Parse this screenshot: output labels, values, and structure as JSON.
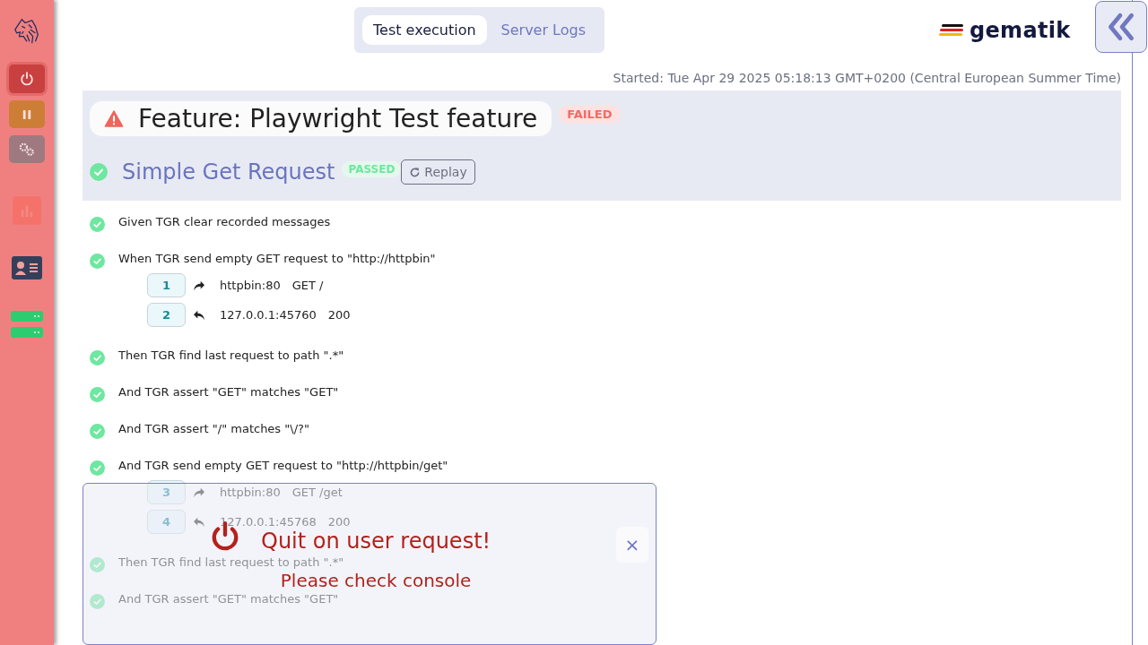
{
  "sidebar": {
    "buttons": [
      {
        "kind": "quit",
        "disabled": false
      },
      {
        "kind": "pause",
        "disabled": false
      },
      {
        "kind": "settings",
        "disabled": false
      },
      {
        "kind": "chart",
        "disabled": true
      },
      {
        "kind": "info",
        "disabled": false
      },
      {
        "kind": "status",
        "disabled": false
      }
    ]
  },
  "tabs": [
    {
      "label": "Test execution",
      "selected": true
    },
    {
      "label": "Server Logs",
      "selected": false
    }
  ],
  "logo": {
    "text": "gematik"
  },
  "started": "Started: Tue Apr 29 2025 05:18:13 GMT+0200 (Central European Summer Time)",
  "feature": {
    "title": "Feature: Playwright Test feature",
    "passed": false,
    "badge": "FAILED",
    "scenario": {
      "title": "Simple Get Request",
      "passed": true,
      "badge": "PASSED",
      "replay": "Replay"
    },
    "steps": [
      {
        "text": "Given TGR clear recorded messages",
        "passed": true
      },
      {
        "text": "When TGR send empty GET request to \"http://httpbin\"",
        "passed": true,
        "messages": [
          {
            "number": "1",
            "kind": "request",
            "host": "httpbin:80",
            "info": "GET /"
          },
          {
            "number": "2",
            "kind": "response",
            "host": "127.0.0.1:45760",
            "info": "200"
          }
        ]
      },
      {
        "text": "Then TGR find last request to path \".*\"",
        "passed": true
      },
      {
        "text": "And TGR assert \"GET\" matches \"GET\"",
        "passed": true
      },
      {
        "text": "And TGR assert \"/\" matches \"\\/?\"",
        "passed": true
      },
      {
        "text": "And TGR send empty GET request to \"http://httpbin/get\"",
        "passed": true,
        "messages": [
          {
            "number": "3",
            "kind": "request",
            "host": "httpbin:80",
            "info": "GET /get"
          },
          {
            "number": "4",
            "kind": "response",
            "host": "127.0.0.1:45768",
            "info": "200"
          }
        ]
      },
      {
        "text": "Then TGR find last request to path \".*\"",
        "passed": true
      },
      {
        "text": "And TGR assert \"GET\" matches \"GET\"",
        "passed": true
      }
    ]
  },
  "toast": {
    "title": "Quit on user request!",
    "message": "Please check console",
    "close": "×"
  }
}
